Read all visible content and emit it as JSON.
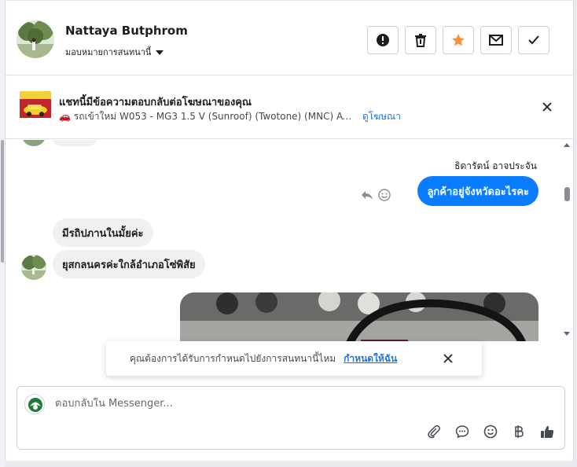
{
  "header": {
    "contact_name": "Nattaya Butphrom",
    "assign_label": "มอบหมายการสนทนานี้",
    "actions": [
      {
        "icon": "alert-icon",
        "color": "#1c1e21"
      },
      {
        "icon": "trash-icon",
        "color": "#1c1e21"
      },
      {
        "icon": "star-icon",
        "color": "#f7923b"
      },
      {
        "icon": "mail-icon",
        "color": "#1c1e21"
      },
      {
        "icon": "check-icon",
        "color": "#1c1e21"
      }
    ]
  },
  "ad_banner": {
    "title": "แชทนี้มีข้อความตอบกลับต่อโฆษณาของคุณ",
    "car_text": "🚗 รถเข้าใหม่ W053 - MG3 1.5 V (Sunroof) (Twotone) (MNC) AT แสง...",
    "link_label": "ดูโฆษณา"
  },
  "messages": {
    "sender_name": "ธิดารัตน์ อาจประจัน",
    "outgoing": "ลูกค้าอยู่จังหวัดอะไรคะ",
    "incoming": [
      "มีรถิปภานในมั้ยค่ะ",
      "ยุสกลนครค่ะใกล้อำเภอโซ่พิสัย"
    ]
  },
  "toast": {
    "text": "คุณต้องการได้รับการกำหนดไปยังการสนทนานี้ไหม",
    "link_label": "กำหนดให้ฉัน"
  },
  "composer": {
    "placeholder": "ตอบกลับใน Messenger...",
    "value": "",
    "tools": [
      "attach-icon",
      "chat-bubble-icon",
      "emoji-icon",
      "baht-icon",
      "thumbs-up-icon"
    ]
  },
  "colors": {
    "accent": "#0a7cff",
    "link": "#1b74e4",
    "star": "#f7923b"
  }
}
